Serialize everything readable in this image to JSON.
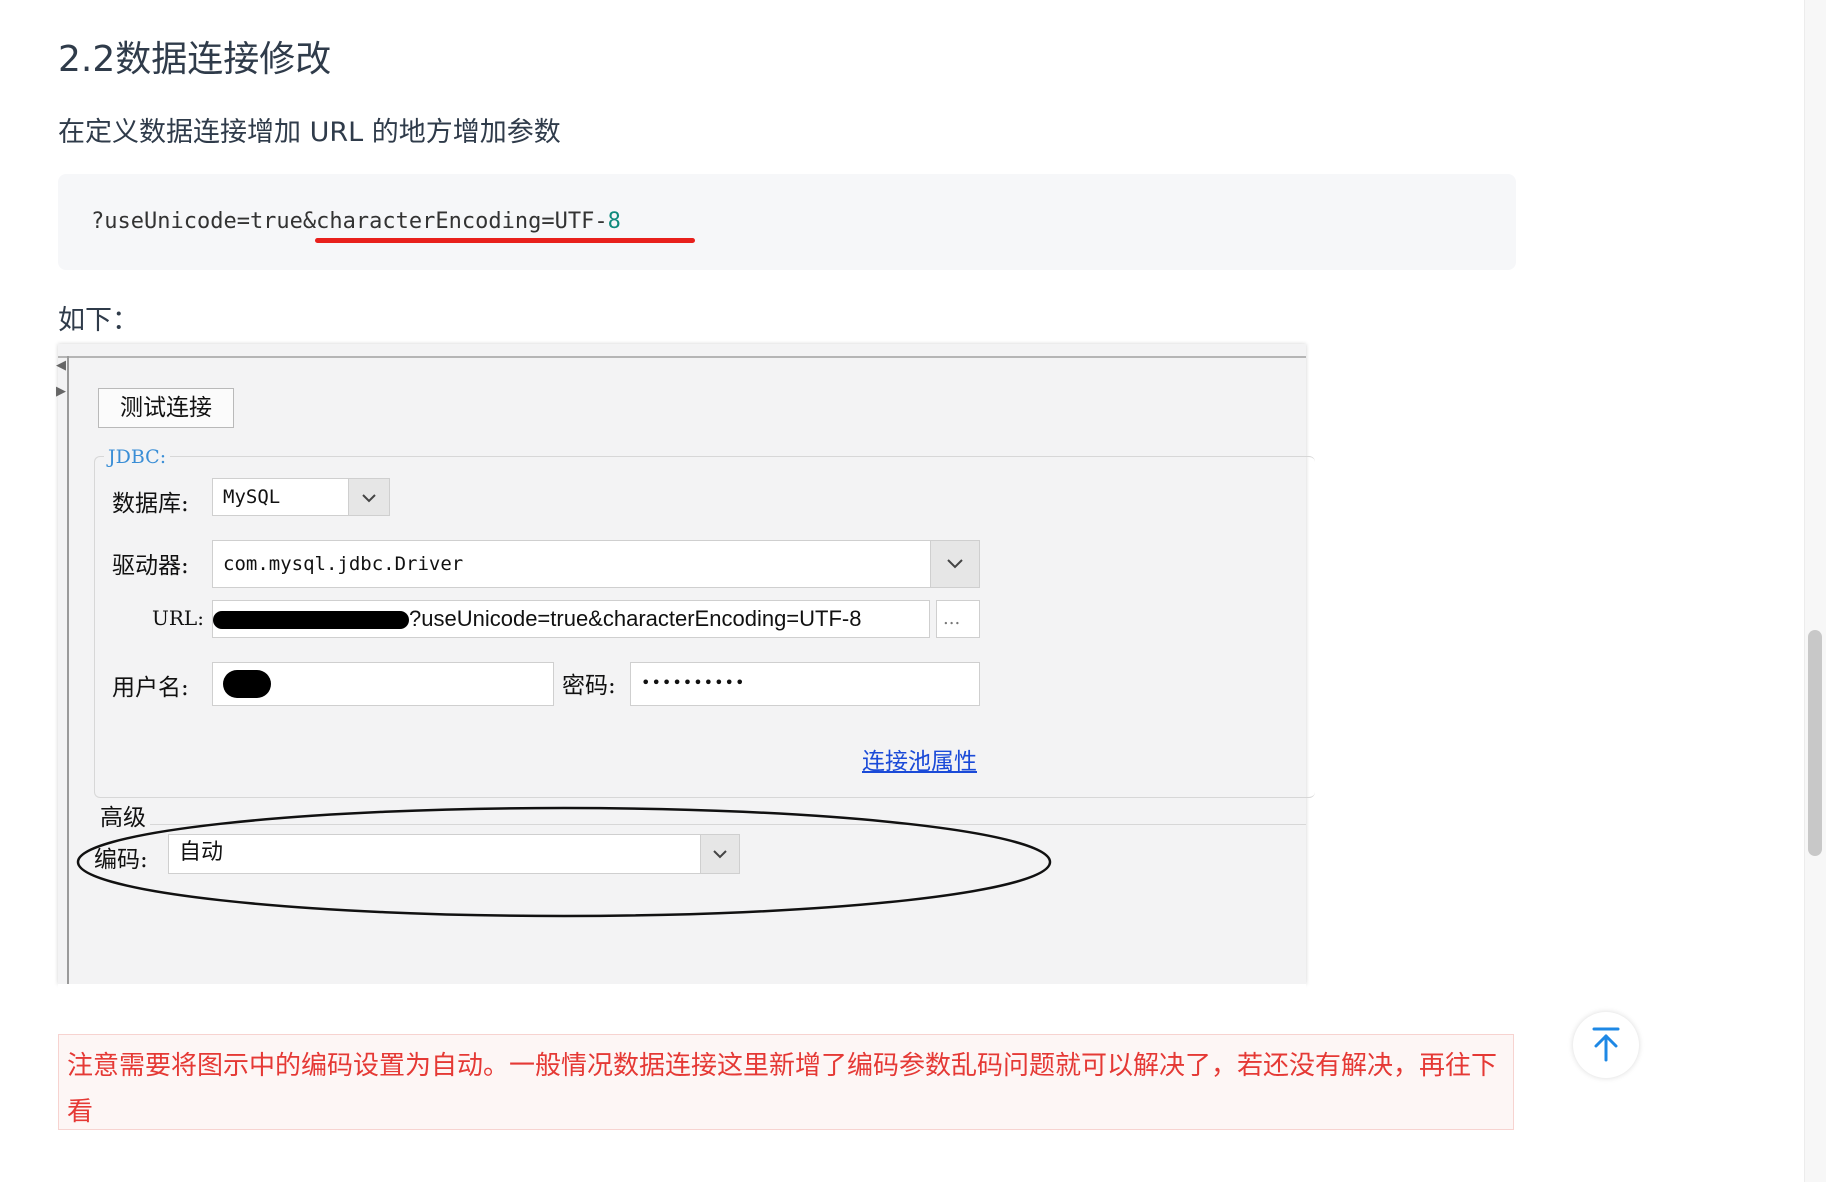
{
  "article": {
    "heading": "2.2数据连接修改",
    "intro": "在定义数据连接增加 URL 的地方增加参数",
    "code": {
      "prefix": "?useUnicode=true&characterEncoding=UTF-",
      "suffix": "8"
    },
    "as_below": "如下：",
    "note": "注意需要将图示中的编码设置为自动。一般情况数据连接这里新增了编码参数乱码问题就可以解决了，若还没有解决，再往下看"
  },
  "screenshot": {
    "test_button": "测试连接",
    "jdbc_label": "JDBC:",
    "database_label": "数据库:",
    "database_value": "MySQL",
    "driver_label": "驱动器:",
    "driver_value": "com.mysql.jdbc.Driver",
    "url_label": "URL:",
    "url_value": "?useUnicode=true&characterEncoding=UTF-8",
    "url_more": "...",
    "username_label": "用户名:",
    "password_label": "密码:",
    "password_value": "••••••••••",
    "pool_link": "连接池属性",
    "advanced_label": "高级",
    "encoding_label": "编码:",
    "encoding_value": "自动"
  },
  "icons": {
    "back_to_top": "arrow-up-to-top-icon",
    "dropdown": "chevron-down-icon"
  },
  "colors": {
    "accent_link": "#1a4ad8",
    "note_text": "#e53935",
    "note_bg": "#fdf6f5",
    "underline": "#e8201c",
    "backtop": "#1e88e5"
  }
}
